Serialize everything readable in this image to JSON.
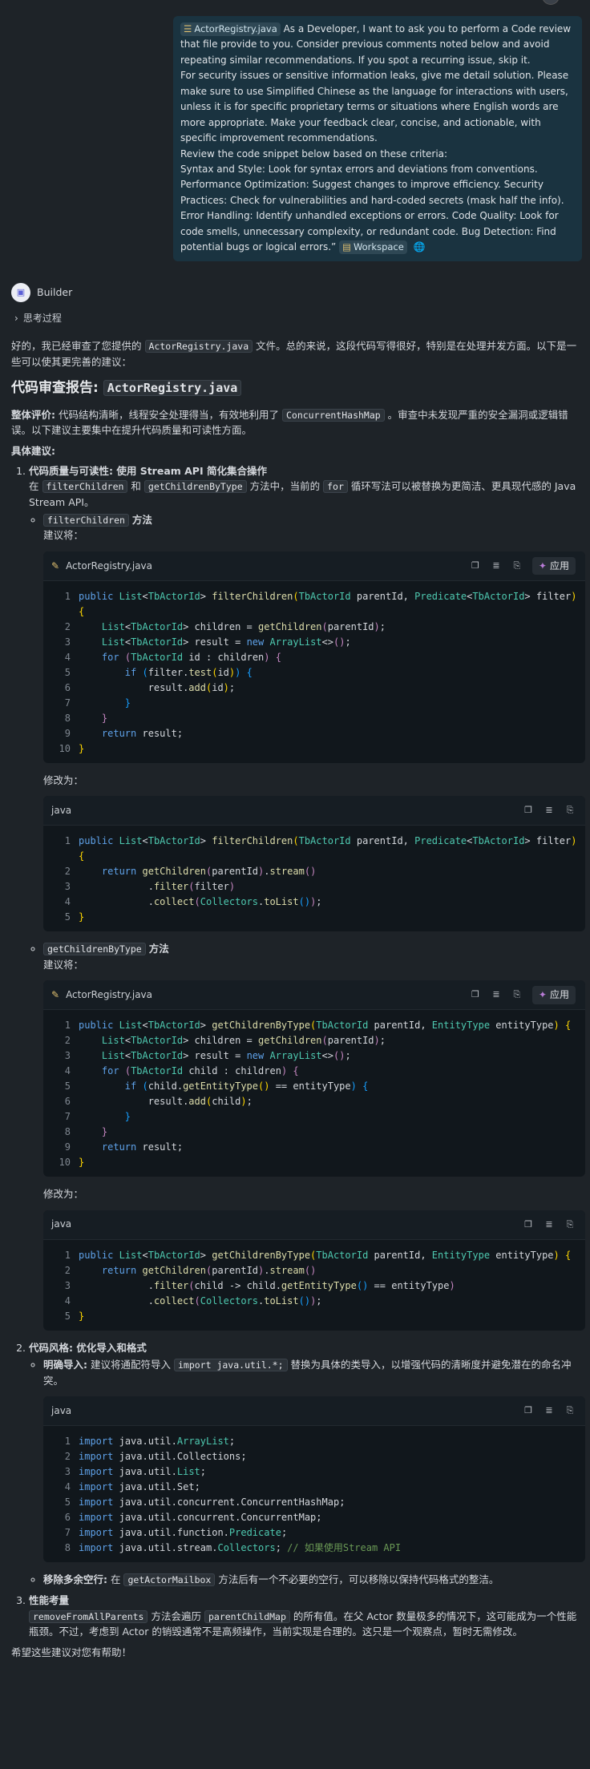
{
  "user_message": {
    "file_chip": "ActorRegistry.java",
    "lines": [
      "As a Developer, I want to ask you to perform a Code review that file provide to you. Consider previous comments noted below and avoid repeating similar recommendations. If you spot a recurring issue, skip it.",
      "For security issues or sensitive information leaks, give me detail solution. Please make sure to use Simplified Chinese as the language for interactions with users, unless it is for specific proprietary terms or situations where English words are more appropriate. Make your feedback clear, concise, and actionable, with specific improvement recommendations.",
      "Review the code snippet below based on these criteria:",
      "Syntax and Style: Look for syntax errors and deviations from conventions. Performance Optimization: Suggest changes to improve efficiency. Security Practices: Check for vulnerabilities and hard-coded secrets (mask half the info). Error Handling: Identify unhandled exceptions or errors. Code Quality: Look for code smells, unnecessary complexity, or redundant code. Bug Detection: Find potential bugs or logical errors.”"
    ],
    "workspace_chip": "Workspace"
  },
  "assistant": {
    "name": "Builder",
    "thinking_label": "思考过程",
    "intro_before": "好的，我已经审查了您提供的",
    "intro_file": "ActorRegistry.java",
    "intro_after": "文件。总的来说，这段代码写得很好，特别是在处理并发方面。以下是一些可以使其更完善的建议：",
    "report_title": "代码审查报告:",
    "report_file": "ActorRegistry.java",
    "overall_label": "整体评价:",
    "overall_before": "代码结构清晰，线程安全处理得当，有效地利用了",
    "overall_code": "ConcurrentHashMap",
    "overall_after": "。审查中未发现严重的安全漏洞或逻辑错误。以下建议主要集中在提升代码质量和可读性方面。",
    "specific_label": "具体建议:",
    "item1": {
      "title": "代码质量与可读性: 使用 Stream API 简化集合操作",
      "desc_1": "在",
      "desc_code1": "filterChildren",
      "desc_2": "和",
      "desc_code2": "getChildrenByType",
      "desc_3": "方法中，当前的",
      "desc_code3": "for",
      "desc_4": "循环写法可以被替换为更简洁、更具现代感的 Java Stream API。",
      "sub1_code": "filterChildren",
      "sub1_label": "方法",
      "sub2_code": "getChildrenByType",
      "sub2_label": "方法",
      "suggest_label": "建议将：",
      "change_label": "修改为："
    },
    "item2": {
      "title": "代码风格: 优化导入和格式",
      "b1_label": "明确导入:",
      "b1_before": "建议将通配符导入",
      "b1_code": "import java.util.*;",
      "b1_after": "替换为具体的类导入，以增强代码的清晰度并避免潜在的命名冲突。",
      "b2_label": "移除多余空行:",
      "b2_before": "在",
      "b2_code": "getActorMailbox",
      "b2_after": "方法后有一个不必要的空行，可以移除以保持代码格式的整洁。"
    },
    "item3": {
      "title": "性能考量",
      "code1": "removeFromAllParents",
      "text1": "方法会遍历",
      "code2": "parentChildMap",
      "text2": "的所有值。在父 Actor 数量极多的情况下，这可能成为一个性能瓶颈。不过，考虑到 Actor 的销毁通常不是高频操作，当前实现是合理的。这只是一个观察点，暂时无需修改。"
    },
    "closing": "希望这些建议对您有帮助！"
  },
  "code_blocks": {
    "apply_label": "应用",
    "b1": {
      "file": "ActorRegistry.java",
      "lines": [
        "public List<TbActorId> filterChildren(TbActorId parentId, Predicate<TbActorId> filter) {",
        "    List<TbActorId> children = getChildren(parentId);",
        "    List<TbActorId> result = new ArrayList<>();",
        "    for (TbActorId id : children) {",
        "        if (filter.test(id)) {",
        "            result.add(id);",
        "        }",
        "    }",
        "    return result;",
        "}"
      ]
    },
    "b2": {
      "file": "java",
      "lines": [
        "public List<TbActorId> filterChildren(TbActorId parentId, Predicate<TbActorId> filter) {",
        "    return getChildren(parentId).stream()",
        "            .filter(filter)",
        "            .collect(Collectors.toList());",
        "}"
      ]
    },
    "b3": {
      "file": "ActorRegistry.java",
      "lines": [
        "public List<TbActorId> getChildrenByType(TbActorId parentId, EntityType entityType) {",
        "    List<TbActorId> children = getChildren(parentId);",
        "    List<TbActorId> result = new ArrayList<>();",
        "    for (TbActorId child : children) {",
        "        if (child.getEntityType() == entityType) {",
        "            result.add(child);",
        "        }",
        "    }",
        "    return result;",
        "}"
      ]
    },
    "b4": {
      "file": "java",
      "lines": [
        "public List<TbActorId> getChildrenByType(TbActorId parentId, EntityType entityType) {",
        "    return getChildren(parentId).stream()",
        "            .filter(child -> child.getEntityType() == entityType)",
        "            .collect(Collectors.toList());",
        "}"
      ]
    },
    "b5": {
      "file": "java",
      "lines": [
        "import java.util.ArrayList;",
        "import java.util.Collections;",
        "import java.util.List;",
        "import java.util.Set;",
        "import java.util.concurrent.ConcurrentHashMap;",
        "import java.util.concurrent.ConcurrentMap;",
        "import java.util.function.Predicate;",
        "import java.util.stream.Collectors; // 如果使用Stream API"
      ]
    }
  }
}
